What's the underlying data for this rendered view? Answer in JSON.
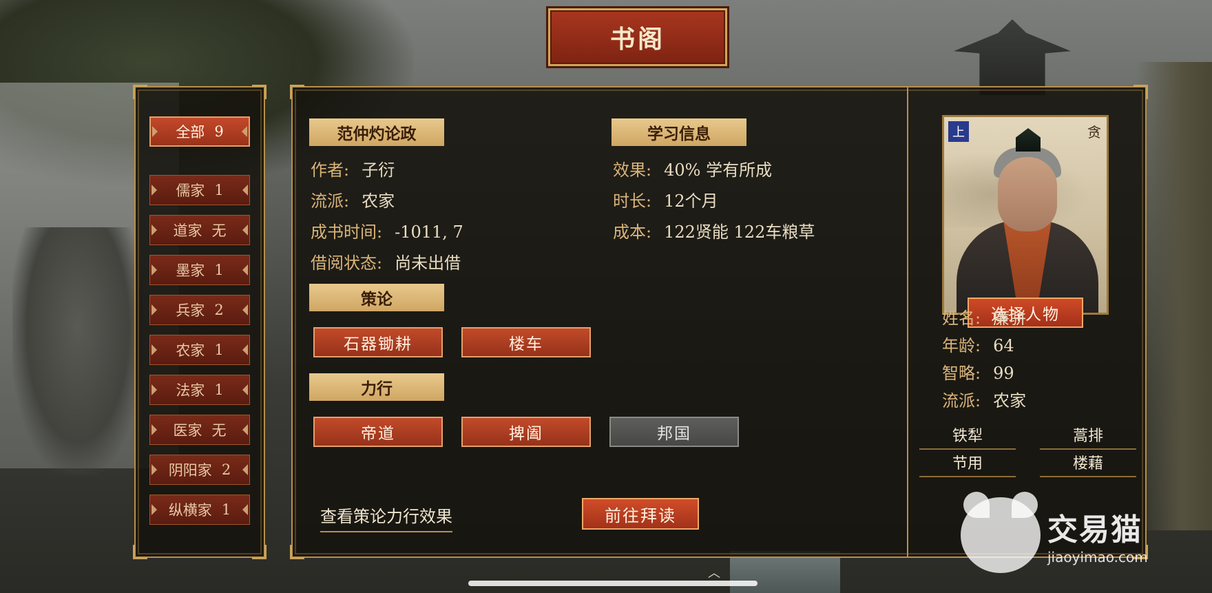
{
  "title": "书阁",
  "filters": [
    {
      "name": "全部",
      "count": "9",
      "active": true
    },
    {
      "name": "儒家",
      "count": "1"
    },
    {
      "name": "道家",
      "count": "无"
    },
    {
      "name": "墨家",
      "count": "1"
    },
    {
      "name": "兵家",
      "count": "2"
    },
    {
      "name": "农家",
      "count": "1"
    },
    {
      "name": "法家",
      "count": "1"
    },
    {
      "name": "医家",
      "count": "无"
    },
    {
      "name": "阴阳家",
      "count": "2"
    },
    {
      "name": "纵横家",
      "count": "1"
    }
  ],
  "book": {
    "title": "范仲灼论政",
    "author_label": "作者:",
    "author": "子衍",
    "school_label": "流派:",
    "school": "农家",
    "written_label": "成书时间:",
    "written": "-1011, 7",
    "loan_label": "借阅状态:",
    "loan": "尚未出借"
  },
  "study": {
    "title": "学习信息",
    "effect_label": "效果:",
    "effect": "40%  学有所成",
    "duration_label": "时长:",
    "duration": "12个月",
    "cost_label": "成本:",
    "cost": "122贤能  122车粮草"
  },
  "celun": {
    "title": "策论",
    "skills": [
      {
        "label": "石器锄耕",
        "disabled": false
      },
      {
        "label": "楼车",
        "disabled": false
      }
    ]
  },
  "lixing": {
    "title": "力行",
    "skills": [
      {
        "label": "帝道",
        "disabled": false
      },
      {
        "label": "捭阖",
        "disabled": false
      },
      {
        "label": "邦国",
        "disabled": true
      }
    ]
  },
  "view_effects_link": "查看策论力行效果",
  "go_read_button": "前往拜读",
  "character": {
    "badge_left": "上",
    "badge_right": "贪",
    "select_button": "选择人物",
    "name_label": "姓名:",
    "name": "廉骈",
    "age_label": "年龄:",
    "age": "64",
    "wisdom_label": "智略:",
    "wisdom": "99",
    "school_label": "流派:",
    "school": "农家",
    "items": [
      "铁犁",
      "蒿排",
      "节用",
      "楼藉"
    ]
  },
  "watermark": {
    "cn": "交易猫",
    "en": "jiaoyimao.com"
  },
  "colors": {
    "panel_border": "#b88f4a",
    "button_red": "#c24a2a",
    "tag_gold": "#e8c98c",
    "disabled_gray": "#5e5e5c"
  }
}
